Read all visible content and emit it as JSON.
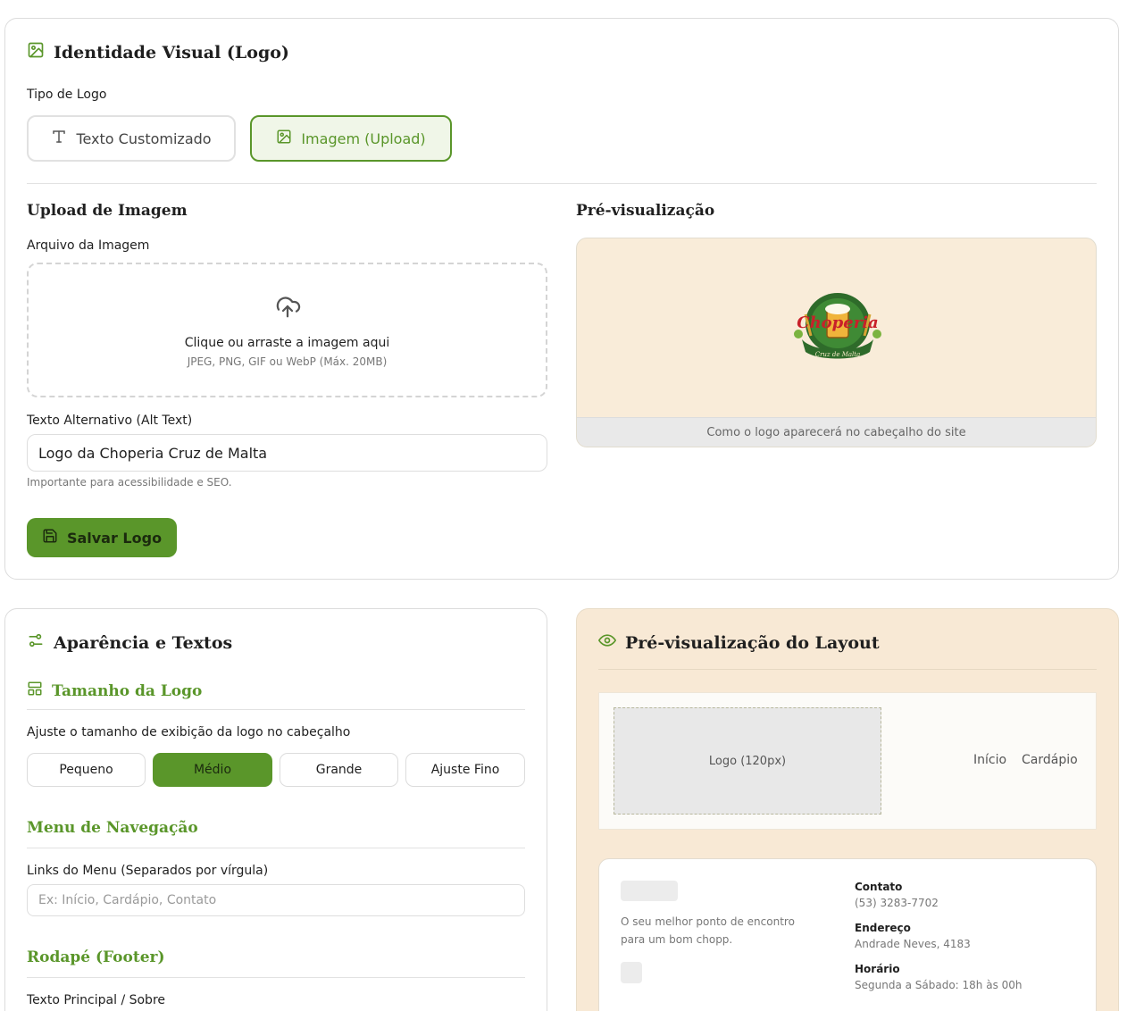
{
  "logo_card": {
    "title": "Identidade Visual (Logo)",
    "logo_type_label": "Tipo de Logo",
    "option_text": "Texto Customizado",
    "option_image": "Imagem (Upload)",
    "upload_title": "Upload de Imagem",
    "file_label": "Arquivo da Imagem",
    "dropzone_main": "Clique ou arraste a imagem aqui",
    "dropzone_sub": "JPEG, PNG, GIF ou WebP (Máx. 20MB)",
    "alt_label": "Texto Alternativo (Alt Text)",
    "alt_value": "Logo da Choperia Cruz de Malta",
    "alt_hint": "Importante para acessibilidade e SEO.",
    "save_button": "Salvar Logo",
    "preview_title": "Pré-visualização",
    "preview_caption": "Como o logo aparecerá no cabeçalho do site",
    "logo_word": "Choperia",
    "logo_ribbon": "Cruz de Malta"
  },
  "appearance_card": {
    "title": "Aparência e Textos",
    "logo_size_title": "Tamanho da Logo",
    "logo_size_desc": "Ajuste o tamanho de exibição da logo no cabeçalho",
    "sizes": [
      "Pequeno",
      "Médio",
      "Grande",
      "Ajuste Fino"
    ],
    "active_size": "Médio",
    "nav_title": "Menu de Navegação",
    "nav_label": "Links do Menu (Separados por vírgula)",
    "nav_placeholder": "Ex: Início, Cardápio, Contato",
    "footer_title": "Rodapé (Footer)",
    "footer_main_label": "Texto Principal / Sobre"
  },
  "layout_preview": {
    "title": "Pré-visualização do Layout",
    "logo_placeholder": "Logo (120px)",
    "nav_items": [
      "Início",
      "Cardápio"
    ],
    "footer_about": "O seu melhor ponto de encontro para um bom chopp.",
    "contact_label": "Contato",
    "contact_value": "(53) 3283-7702",
    "address_label": "Endereço",
    "address_value": "Andrade Neves, 4183",
    "hours_label": "Horário",
    "hours_value": "Segunda a Sábado: 18h às 00h"
  },
  "colors": {
    "accent": "#5a962a",
    "cream": "#f8e9d5"
  }
}
